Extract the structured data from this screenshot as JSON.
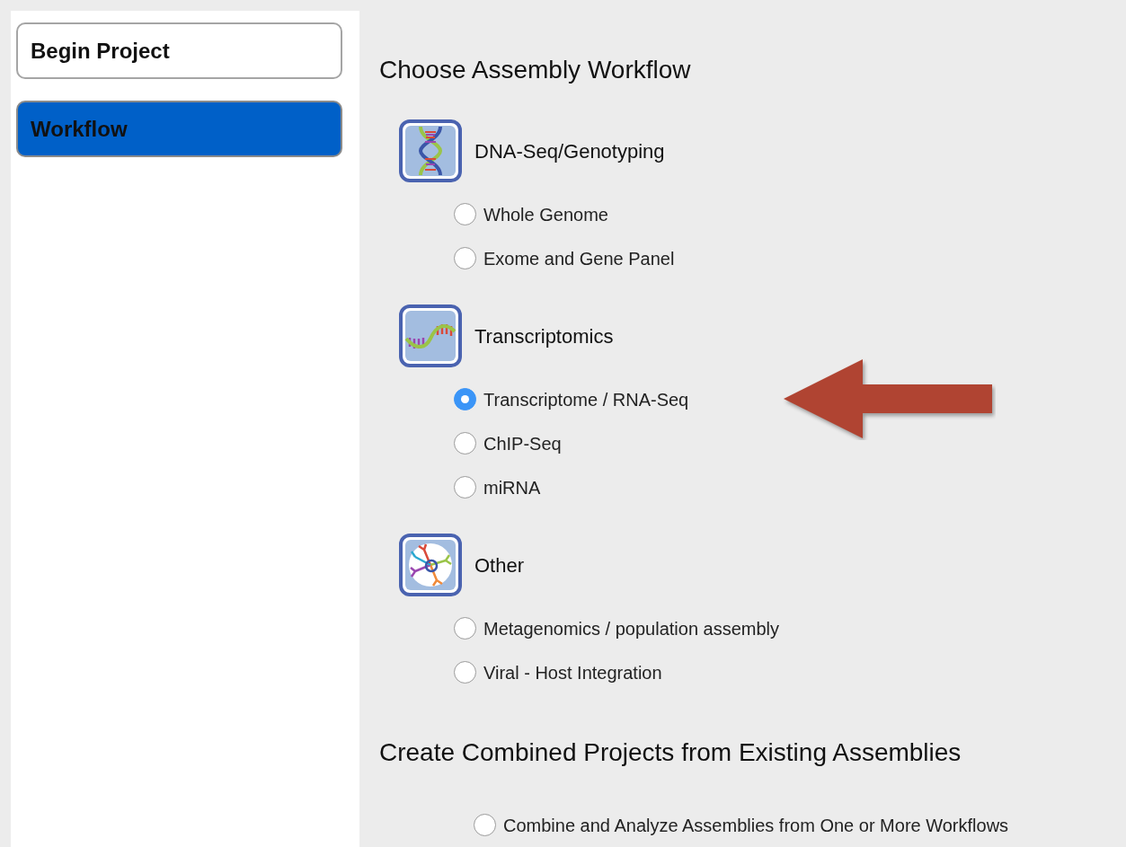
{
  "sidebar": {
    "items": [
      {
        "label": "Begin Project",
        "selected": false
      },
      {
        "label": "Workflow",
        "selected": true
      }
    ]
  },
  "sections": [
    {
      "heading": "Choose Assembly Workflow",
      "groups": [
        {
          "title": "DNA-Seq/Genotyping",
          "kind": "dna",
          "options": [
            {
              "label": "Whole Genome",
              "selected": false
            },
            {
              "label": "Exome and Gene Panel",
              "selected": false
            }
          ]
        },
        {
          "title": "Transcriptomics",
          "kind": "wave",
          "options": [
            {
              "label": "Transcriptome / RNA-Seq",
              "selected": true
            },
            {
              "label": "ChIP-Seq",
              "selected": false
            },
            {
              "label": "miRNA",
              "selected": false
            }
          ]
        },
        {
          "title": "Other",
          "kind": "tree",
          "options": [
            {
              "label": "Metagenomics / population assembly",
              "selected": false
            },
            {
              "label": "Viral - Host Integration",
              "selected": false
            }
          ]
        }
      ]
    },
    {
      "heading": "Create Combined Projects from Existing Assemblies",
      "options": [
        {
          "label": "Combine and Analyze Assemblies from One or More Workflows",
          "selected": false
        }
      ]
    }
  ]
}
